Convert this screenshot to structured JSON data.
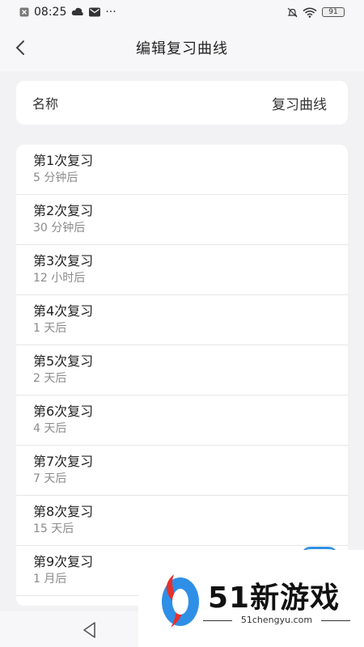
{
  "status_bar": {
    "time": "08:25",
    "left_icons": [
      "close-box-icon",
      "cloud-icon",
      "mail-icon",
      "more-dots-icon"
    ],
    "right_icons": [
      "mute-bell-icon",
      "wifi-icon"
    ],
    "battery": "91"
  },
  "header": {
    "title": "编辑复习曲线",
    "back_icon": "chevron-left-icon"
  },
  "name_row": {
    "label": "名称",
    "value": "复习曲线"
  },
  "reviews": [
    {
      "title": "第1次复习",
      "interval": "5 分钟后"
    },
    {
      "title": "第2次复习",
      "interval": "30 分钟后"
    },
    {
      "title": "第3次复习",
      "interval": "12 小时后"
    },
    {
      "title": "第4次复习",
      "interval": "1 天后"
    },
    {
      "title": "第5次复习",
      "interval": "2 天后"
    },
    {
      "title": "第6次复习",
      "interval": "4 天后"
    },
    {
      "title": "第7次复习",
      "interval": "7 天后"
    },
    {
      "title": "第8次复习",
      "interval": "15 天后"
    },
    {
      "title": "第9次复习",
      "interval": "1 月后"
    }
  ],
  "watermark": {
    "brand": "51新游戏",
    "url": "51chengyu.com"
  },
  "colors": {
    "background": "#f2f2f4",
    "card": "#ffffff",
    "accent_blue": "#2f8fe6",
    "accent_red": "#e8302a"
  }
}
